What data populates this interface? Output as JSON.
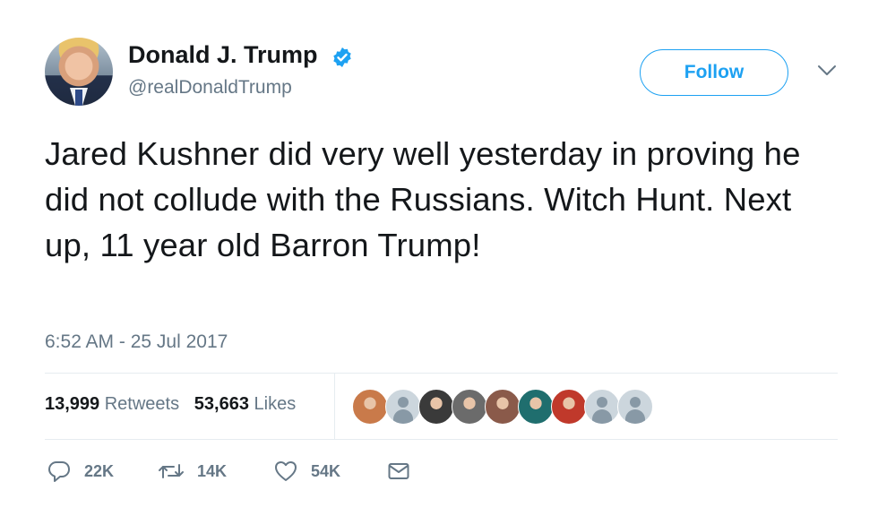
{
  "author": {
    "name": "Donald J. Trump",
    "handle": "@realDonaldTrump",
    "verified_icon": "verified-badge-icon"
  },
  "follow_label": "Follow",
  "tweet": {
    "text": "Jared Kushner did very well yesterday in proving he did not collude with the Russians. Witch Hunt. Next up, 11 year old Barron Trump!",
    "timestamp": "6:52 AM - 25 Jul 2017"
  },
  "stats": {
    "retweets_count": "13,999",
    "retweets_label": "Retweets",
    "likes_count": "53,663",
    "likes_label": "Likes"
  },
  "likers": [
    {
      "type": "photo",
      "color": "#c97a4a"
    },
    {
      "type": "default"
    },
    {
      "type": "photo",
      "color": "#3a3a3a"
    },
    {
      "type": "photo",
      "color": "#6b6b6b"
    },
    {
      "type": "photo",
      "color": "#8a5a4a"
    },
    {
      "type": "photo",
      "color": "#1f6e6e"
    },
    {
      "type": "photo",
      "color": "#c0392b"
    },
    {
      "type": "default"
    },
    {
      "type": "default"
    }
  ],
  "actions": {
    "reply_count": "22K",
    "retweet_count": "14K",
    "like_count": "54K"
  },
  "colors": {
    "accent": "#1da1f2",
    "secondary_text": "#657786",
    "divider": "#e6ecf0"
  }
}
